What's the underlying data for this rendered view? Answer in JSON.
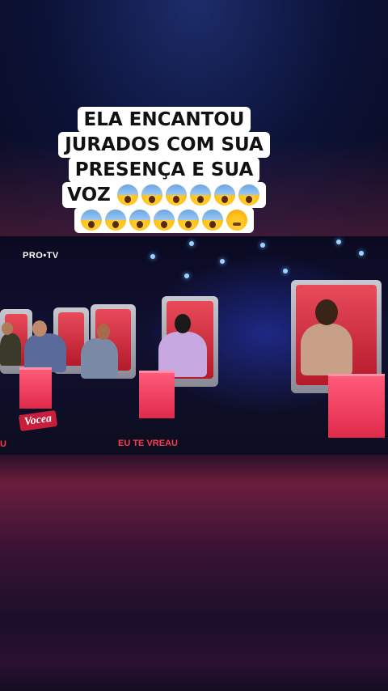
{
  "caption": {
    "lines": [
      "ELA ENCANTOU",
      "JURADOS COM SUA",
      "PRESENÇA E SUA",
      "VOZ"
    ],
    "emoji_row1": [
      "face-screaming-in-fear-icon",
      "face-screaming-in-fear-icon",
      "face-screaming-in-fear-icon",
      "face-screaming-in-fear-icon",
      "face-screaming-in-fear-icon",
      "face-screaming-in-fear-icon"
    ],
    "emoji_row2": [
      "face-screaming-in-fear-icon",
      "face-screaming-in-fear-icon",
      "face-screaming-in-fear-icon",
      "face-screaming-in-fear-icon",
      "face-screaming-in-fear-icon",
      "face-screaming-in-fear-icon",
      "face-with-steam-icon"
    ]
  },
  "video": {
    "channel_logo": "PRO•TV",
    "show_logo": "Vocea",
    "floor_text": "EU TE VREAU",
    "floor_text_left": "U"
  },
  "colors": {
    "chair_red": "#e02a4a",
    "pedestal_pink": "#ff5a7a",
    "background_top": "#0b1236",
    "background_bottom": "#3a1234"
  }
}
